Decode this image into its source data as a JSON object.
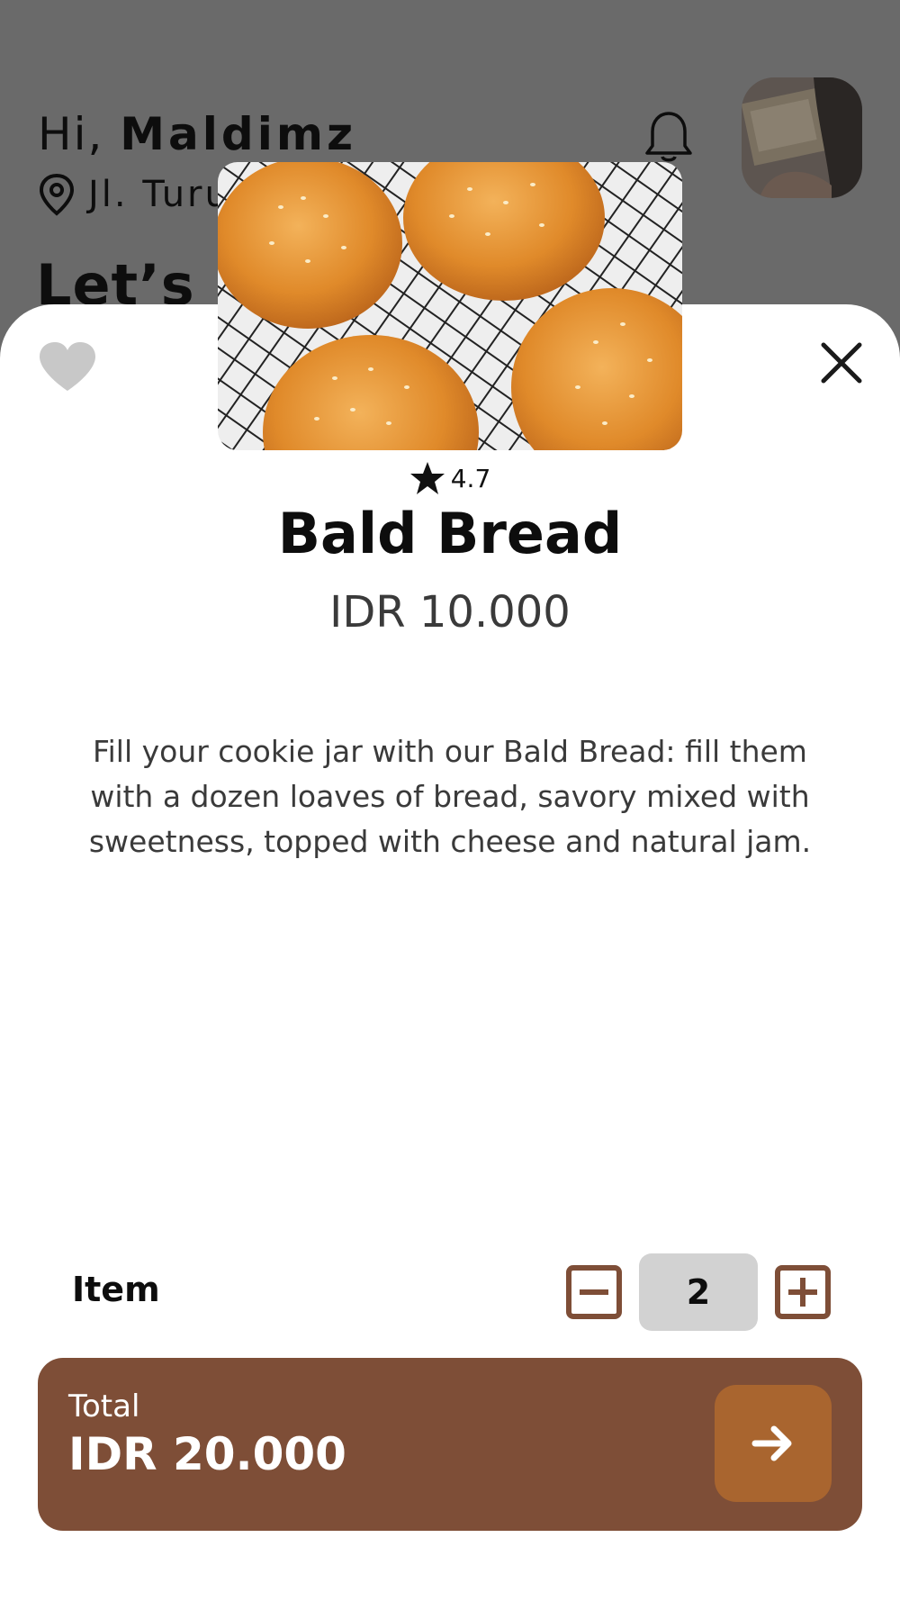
{
  "background": {
    "greeting_prefix": "Hi,",
    "user_name": "Maldimz",
    "location": "Jl. Turu",
    "headline": "Let’s B"
  },
  "product": {
    "rating": "4.7",
    "name": "Bald Bread",
    "price": "IDR 10.000",
    "description": "Fill your cookie jar with our Bald Bread: fill them with a dozen loaves of bread, savory mixed with sweetness, topped with cheese and natural jam."
  },
  "quantity": {
    "label": "Item",
    "value": "2"
  },
  "checkout": {
    "total_label": "Total",
    "total_amount": "IDR 20.000"
  },
  "colors": {
    "accent_brown": "#7e4e37",
    "button_orange": "#a9652f",
    "qty_icon": "#7e4e37"
  },
  "icons": {
    "favorite": "heart-icon",
    "close": "close-icon",
    "rating": "star-icon",
    "notification": "bell-icon",
    "location": "map-pin-icon",
    "decrement": "minus-square-icon",
    "increment": "plus-square-icon",
    "proceed": "arrow-right-icon"
  }
}
